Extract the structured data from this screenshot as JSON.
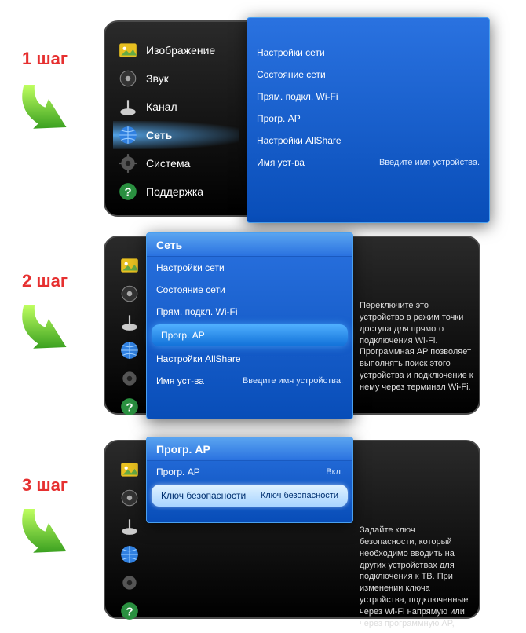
{
  "steps": {
    "s1": "1 шаг",
    "s2": "2 шаг",
    "s3": "3 шаг"
  },
  "panel1": {
    "sidebar": [
      {
        "label": "Изображение",
        "icon": "picture"
      },
      {
        "label": "Звук",
        "icon": "sound"
      },
      {
        "label": "Канал",
        "icon": "channel"
      },
      {
        "label": "Сеть",
        "icon": "network",
        "selected": true
      },
      {
        "label": "Система",
        "icon": "system"
      },
      {
        "label": "Поддержка",
        "icon": "support"
      }
    ],
    "submenu": {
      "items": [
        {
          "label": "Настройки сети"
        },
        {
          "label": "Состояние сети"
        },
        {
          "label": "Прям. подкл. Wi-Fi"
        },
        {
          "label": "Прогр. AP"
        },
        {
          "label": "Настройки AllShare"
        },
        {
          "label": "Имя уст-ва",
          "value": "Введите имя устройства."
        }
      ]
    }
  },
  "panel2": {
    "submenu": {
      "header": "Сеть",
      "items": [
        {
          "label": "Настройки сети"
        },
        {
          "label": "Состояние сети"
        },
        {
          "label": "Прям. подкл. Wi-Fi"
        },
        {
          "label": "Прогр. AP",
          "selected": true
        },
        {
          "label": "Настройки AllShare"
        },
        {
          "label": "Имя уст-ва",
          "value": "Введите имя устройства."
        }
      ]
    },
    "desc": "Переключите это устройство в режим точки доступа для прямого подключения Wi-Fi. Программная AP позволяет выполнять поиск этого устройства и подключение к нему через терминал Wi-Fi."
  },
  "panel3": {
    "submenu": {
      "header": "Прогр. AP",
      "items": [
        {
          "label": "Прогр. AP",
          "value": "Вкл."
        },
        {
          "label": "Ключ безопасности",
          "value": "Ключ безопасности",
          "selected": true
        }
      ]
    },
    "desc": "Задайте ключ безопасности, который необходимо вводить на других устройствах для подключения к ТВ. При изменении ключа устройства, подключенные через Wi-Fi напрямую или через программную AP,"
  }
}
